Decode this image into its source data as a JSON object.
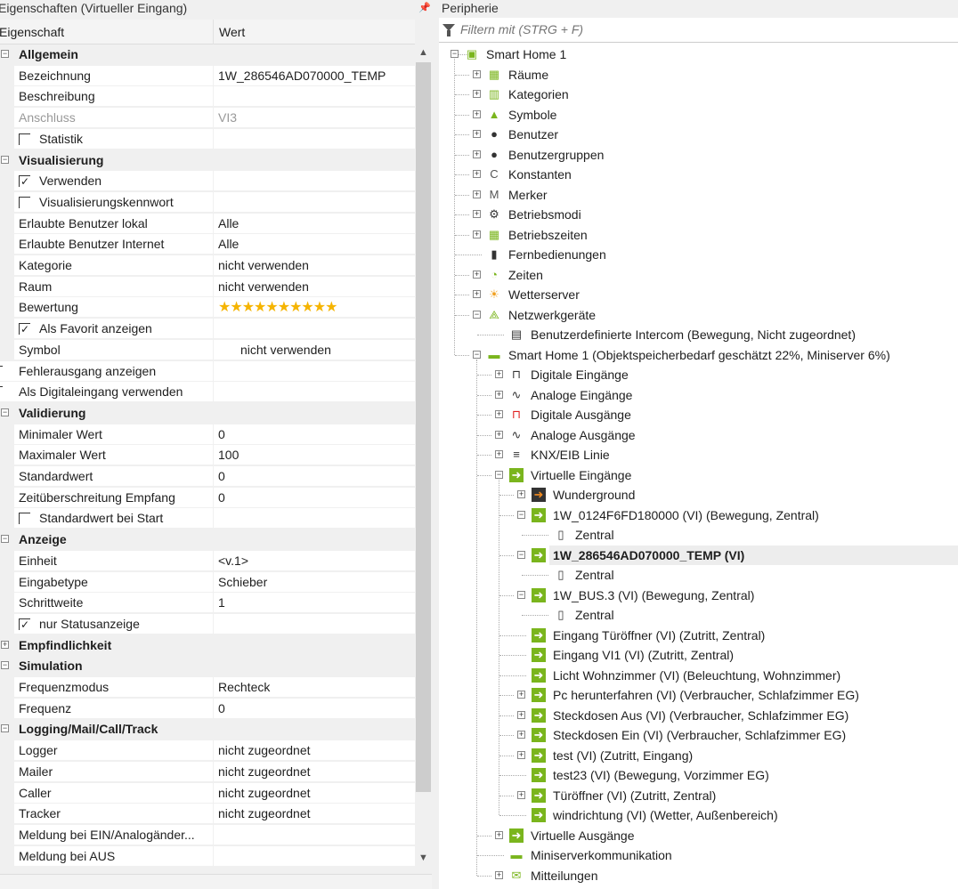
{
  "properties_panel": {
    "title": "Eigenschaften (Virtueller Eingang)",
    "col_property": "Eigenschaft",
    "col_value": "Wert",
    "rows": [
      {
        "type": "sec",
        "label": "Allgemein",
        "expanded": true
      },
      {
        "type": "prop",
        "label": "Bezeichnung",
        "value": "1W_286546AD070000_TEMP"
      },
      {
        "type": "prop",
        "label": "Beschreibung",
        "value": ""
      },
      {
        "type": "prop",
        "label": "Anschluss",
        "value": "VI3",
        "disabled": true
      },
      {
        "type": "check",
        "label": "Statistik",
        "checked": false
      },
      {
        "type": "sec",
        "label": "Visualisierung",
        "expanded": true
      },
      {
        "type": "check",
        "label": "Verwenden",
        "checked": true
      },
      {
        "type": "check",
        "label": "Visualisierungskennwort",
        "checked": false
      },
      {
        "type": "prop",
        "label": "Erlaubte Benutzer lokal",
        "value": "Alle"
      },
      {
        "type": "prop",
        "label": "Erlaubte Benutzer Internet",
        "value": "Alle"
      },
      {
        "type": "prop",
        "label": "Kategorie",
        "value": "nicht verwenden"
      },
      {
        "type": "prop",
        "label": "Raum",
        "value": "nicht verwenden"
      },
      {
        "type": "rating",
        "label": "Bewertung",
        "value": "★★★★★★★★★★",
        "stars": 10
      },
      {
        "type": "check",
        "label": "Als Favorit anzeigen",
        "checked": true
      },
      {
        "type": "prop",
        "label": "Symbol",
        "value": "nicht verwenden",
        "indent": true
      },
      {
        "type": "prop",
        "label": "Fehlerausgang anzeigen",
        "value": "",
        "cutcheck": true
      },
      {
        "type": "prop",
        "label": "Als Digitaleingang verwenden",
        "value": "",
        "cutcheck": true
      },
      {
        "type": "sec",
        "label": "Validierung",
        "expanded": true
      },
      {
        "type": "prop",
        "label": "Minimaler Wert",
        "value": "0"
      },
      {
        "type": "prop",
        "label": "Maximaler Wert",
        "value": "100"
      },
      {
        "type": "prop",
        "label": "Standardwert",
        "value": "0"
      },
      {
        "type": "prop",
        "label": "Zeitüberschreitung Empfang",
        "value": "0"
      },
      {
        "type": "check",
        "label": "Standardwert bei Start",
        "checked": false
      },
      {
        "type": "sec",
        "label": "Anzeige",
        "expanded": true
      },
      {
        "type": "prop",
        "label": "Einheit",
        "value": "<v.1>"
      },
      {
        "type": "prop",
        "label": "Eingabetype",
        "value": "Schieber"
      },
      {
        "type": "prop",
        "label": "Schrittweite",
        "value": "1"
      },
      {
        "type": "check",
        "label": "nur Statusanzeige",
        "checked": true
      },
      {
        "type": "sec",
        "label": "Empfindlichkeit",
        "expanded": false
      },
      {
        "type": "sec",
        "label": "Simulation",
        "expanded": true
      },
      {
        "type": "prop",
        "label": "Frequenzmodus",
        "value": "Rechteck"
      },
      {
        "type": "prop",
        "label": "Frequenz",
        "value": "0"
      },
      {
        "type": "sec",
        "label": "Logging/Mail/Call/Track",
        "expanded": true
      },
      {
        "type": "prop",
        "label": "Logger",
        "value": "nicht zugeordnet"
      },
      {
        "type": "prop",
        "label": "Mailer",
        "value": "nicht zugeordnet"
      },
      {
        "type": "prop",
        "label": "Caller",
        "value": "nicht zugeordnet"
      },
      {
        "type": "prop",
        "label": "Tracker",
        "value": "nicht zugeordnet"
      },
      {
        "type": "prop",
        "label": "Meldung bei EIN/Analogänder...",
        "value": ""
      },
      {
        "type": "prop",
        "label": "Meldung bei AUS",
        "value": ""
      }
    ]
  },
  "peripherie_panel": {
    "title": "Peripherie",
    "filter_placeholder": "Filtern mit (STRG + F)",
    "tree": [
      {
        "level": 0,
        "toggle": "-",
        "icon": "smarthome",
        "label": "Smart Home 1"
      },
      {
        "level": 1,
        "toggle": "+",
        "icon": "rooms",
        "label": "Räume"
      },
      {
        "level": 1,
        "toggle": "+",
        "icon": "categories",
        "label": "Kategorien"
      },
      {
        "level": 1,
        "toggle": "+",
        "icon": "image",
        "label": "Symbole"
      },
      {
        "level": 1,
        "toggle": "+",
        "icon": "user",
        "label": "Benutzer"
      },
      {
        "level": 1,
        "toggle": "+",
        "icon": "users",
        "label": "Benutzergruppen"
      },
      {
        "level": 1,
        "toggle": "+",
        "icon": "C",
        "label": "Konstanten"
      },
      {
        "level": 1,
        "toggle": "+",
        "icon": "M",
        "label": "Merker"
      },
      {
        "level": 1,
        "toggle": "+",
        "icon": "gear",
        "label": "Betriebsmodi"
      },
      {
        "level": 1,
        "toggle": "+",
        "icon": "calendar",
        "label": "Betriebszeiten"
      },
      {
        "level": 1,
        "toggle": "",
        "icon": "remote",
        "label": "Fernbedienungen"
      },
      {
        "level": 1,
        "toggle": "+",
        "icon": "clock",
        "label": "Zeiten"
      },
      {
        "level": 1,
        "toggle": "+",
        "icon": "weather",
        "label": "Wetterserver"
      },
      {
        "level": 1,
        "toggle": "-",
        "icon": "network",
        "label": "Netzwerkgeräte"
      },
      {
        "level": 2,
        "toggle": "",
        "icon": "intercom",
        "label": "Benutzerdefinierte Intercom (Bewegung, Nicht zugeordnet)"
      },
      {
        "level": 1,
        "toggle": "-",
        "icon": "miniserver",
        "label": "Smart Home 1 (Objektspeicherbedarf geschätzt 22%, Miniserver 6%)"
      },
      {
        "level": 2,
        "toggle": "+",
        "icon": "digital-in",
        "label": "Digitale Eingänge"
      },
      {
        "level": 2,
        "toggle": "+",
        "icon": "analog-in",
        "label": "Analoge Eingänge"
      },
      {
        "level": 2,
        "toggle": "+",
        "icon": "digital-out",
        "label": "Digitale Ausgänge"
      },
      {
        "level": 2,
        "toggle": "+",
        "icon": "analog-out",
        "label": "Analoge Ausgänge"
      },
      {
        "level": 2,
        "toggle": "+",
        "icon": "knx",
        "label": "KNX/EIB Linie"
      },
      {
        "level": 2,
        "toggle": "-",
        "icon": "vi",
        "label": "Virtuelle Eingänge"
      },
      {
        "level": 3,
        "toggle": "+",
        "icon": "vi-dark",
        "label": "Wunderground"
      },
      {
        "level": 3,
        "toggle": "-",
        "icon": "vi",
        "label": "1W_0124F6FD180000 (VI) (Bewegung, Zentral)"
      },
      {
        "level": 4,
        "toggle": "",
        "icon": "doc",
        "label": "Zentral"
      },
      {
        "level": 3,
        "toggle": "-",
        "icon": "vi",
        "label": "1W_286546AD070000_TEMP (VI)",
        "selected": true
      },
      {
        "level": 4,
        "toggle": "",
        "icon": "doc",
        "label": "Zentral"
      },
      {
        "level": 3,
        "toggle": "-",
        "icon": "vi",
        "label": "1W_BUS.3 (VI) (Bewegung, Zentral)"
      },
      {
        "level": 4,
        "toggle": "",
        "icon": "doc",
        "label": "Zentral"
      },
      {
        "level": 3,
        "toggle": "",
        "icon": "vi",
        "label": "Eingang Türöffner (VI) (Zutritt, Zentral)"
      },
      {
        "level": 3,
        "toggle": "",
        "icon": "vi",
        "label": "Eingang VI1 (VI) (Zutritt, Zentral)"
      },
      {
        "level": 3,
        "toggle": "",
        "icon": "vi",
        "label": "Licht Wohnzimmer (VI) (Beleuchtung, Wohnzimmer)"
      },
      {
        "level": 3,
        "toggle": "+",
        "icon": "vi",
        "label": "Pc herunterfahren (VI) (Verbraucher, Schlafzimmer EG)"
      },
      {
        "level": 3,
        "toggle": "+",
        "icon": "vi",
        "label": "Steckdosen Aus (VI) (Verbraucher, Schlafzimmer EG)"
      },
      {
        "level": 3,
        "toggle": "+",
        "icon": "vi",
        "label": "Steckdosen Ein (VI) (Verbraucher, Schlafzimmer EG)"
      },
      {
        "level": 3,
        "toggle": "+",
        "icon": "vi",
        "label": "test (VI) (Zutritt, Eingang)"
      },
      {
        "level": 3,
        "toggle": "",
        "icon": "vi",
        "label": "test23 (VI) (Bewegung, Vorzimmer EG)"
      },
      {
        "level": 3,
        "toggle": "+",
        "icon": "vi",
        "label": "Türöffner (VI) (Zutritt, Zentral)"
      },
      {
        "level": 3,
        "toggle": "",
        "icon": "vi",
        "label": "windrichtung (VI) (Wetter, Außenbereich)"
      },
      {
        "level": 2,
        "toggle": "+",
        "icon": "vi",
        "label": "Virtuelle Ausgänge"
      },
      {
        "level": 2,
        "toggle": "",
        "icon": "miniserver",
        "label": "Miniserverkommunikation"
      },
      {
        "level": 2,
        "toggle": "+",
        "icon": "messages",
        "label": "Mitteilungen"
      }
    ]
  },
  "colors": {
    "accent_green": "#7ab51d",
    "star": "#f5b400",
    "selection": "#ededed"
  }
}
